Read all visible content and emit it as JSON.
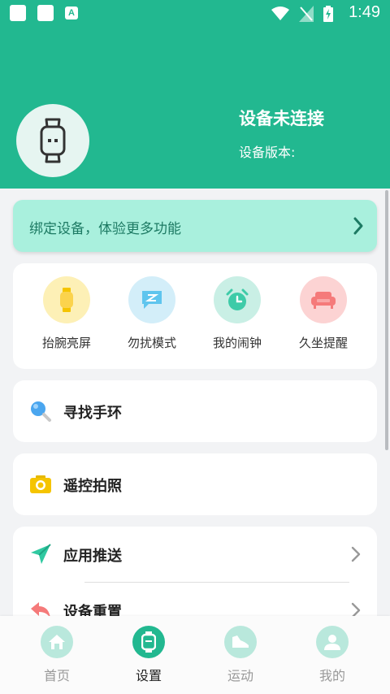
{
  "status_bar": {
    "time": "1:49",
    "app_badge": "A"
  },
  "header": {
    "title": "设备未连接",
    "version_label": "设备版本:"
  },
  "bind_banner": {
    "label": "绑定设备，体验更多功能"
  },
  "quick_actions": [
    {
      "label": "抬腕亮屏",
      "icon": "raise-wrist-icon",
      "color": "#fbd34d"
    },
    {
      "label": "勿扰模式",
      "icon": "do-not-disturb-icon",
      "color": "#5fc5ee"
    },
    {
      "label": "我的闹钟",
      "icon": "alarm-clock-icon",
      "color": "#3ecba8"
    },
    {
      "label": "久坐提醒",
      "icon": "sofa-icon",
      "color": "#f57a7a"
    }
  ],
  "menu": {
    "find_band": "寻找手环",
    "remote_camera": "遥控拍照",
    "app_push": "应用推送",
    "device_reset": "设备重置"
  },
  "bottom_nav": [
    {
      "label": "首页",
      "icon": "home-icon",
      "active": false
    },
    {
      "label": "设置",
      "icon": "watch-icon",
      "active": true
    },
    {
      "label": "运动",
      "icon": "shoe-icon",
      "active": false
    },
    {
      "label": "我的",
      "icon": "person-icon",
      "active": false
    }
  ],
  "colors": {
    "accent": "#22b890",
    "banner_bg": "#a9f0dd",
    "page_bg": "#f2f3f5"
  }
}
